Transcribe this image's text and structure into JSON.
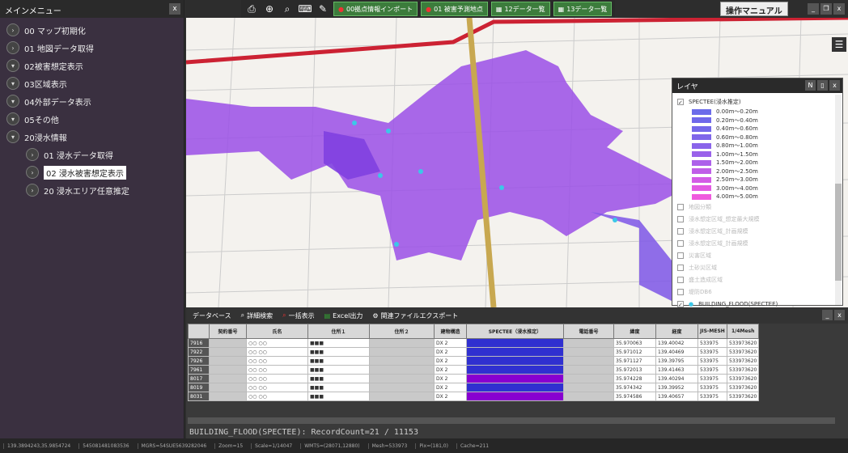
{
  "sidebar": {
    "title": "メインメニュー",
    "close": "x",
    "items": [
      {
        "label": "00 マップ初期化",
        "icon": "›"
      },
      {
        "label": "01 地図データ取得",
        "icon": "›"
      },
      {
        "label": "02被害想定表示",
        "icon": "▾"
      },
      {
        "label": "03区域表示",
        "icon": "▾"
      },
      {
        "label": "04外部データ表示",
        "icon": "▾"
      },
      {
        "label": "05その他",
        "icon": "▾"
      },
      {
        "label": "20浸水情報",
        "icon": "▾"
      }
    ],
    "subitems": [
      {
        "label": "01 浸水データ取得"
      },
      {
        "label": "02 浸水被害想定表示"
      },
      {
        "label": "20 浸水エリア任意推定"
      }
    ]
  },
  "toolbar": {
    "btn1": "00拠点情報インポート",
    "btn2": "01 被害予測地点",
    "btn3": "12データ一覧",
    "btn4": "13データ一覧",
    "manual": "操作マニュアル"
  },
  "layer": {
    "title": "レイヤ",
    "group": "SPECTEE(浸水推定)",
    "legend": [
      {
        "label": "0.00m〜0.20m",
        "color": "#6b6bea"
      },
      {
        "label": "0.20m〜0.40m",
        "color": "#6f68ea"
      },
      {
        "label": "0.40m〜0.60m",
        "color": "#7468ea"
      },
      {
        "label": "0.60m〜0.80m",
        "color": "#7f66ea"
      },
      {
        "label": "0.80m〜1.00m",
        "color": "#8a64ea"
      },
      {
        "label": "1.00m〜1.50m",
        "color": "#9a62ea"
      },
      {
        "label": "1.50m〜2.00m",
        "color": "#ad60ea"
      },
      {
        "label": "2.00m〜2.50m",
        "color": "#c05ee8"
      },
      {
        "label": "2.50m〜3.00m",
        "color": "#d35ce6"
      },
      {
        "label": "3.00m〜4.00m",
        "color": "#e35ae3"
      },
      {
        "label": "4.00m〜5.00m",
        "color": "#ef5ade"
      }
    ],
    "layers": [
      "地図分類",
      "浸水想定区域_想定最大規模",
      "浸水想定区域_計画規模",
      "浸水想定区域_計画規模",
      "災害区域",
      "土砂災区域",
      "盛土造成区域",
      "堤防DB6"
    ],
    "building": "BUILDING_FLOOD(SPECTEE)"
  },
  "bottom": {
    "tools": [
      "データベース",
      "詳細検索",
      "一括表示",
      "Excel出力",
      "関連ファイルエクスポート"
    ],
    "columns": [
      "",
      "契約番号",
      "氏名",
      "住所１",
      "住所２",
      "建物構造",
      "SPECTEE（浸水推定）",
      "電話番号",
      "緯度",
      "経度",
      "JIS-MESH",
      "1/4Mesh"
    ],
    "rows": [
      {
        "id": "7916",
        "name": "○○ ○○",
        "addr": "■■■",
        "s1": "DX",
        "s2": "2",
        "lat": "35.970063",
        "lon": "139.40042",
        "mesh": "533975",
        "q": "533973620",
        "color": "#3030d0"
      },
      {
        "id": "7922",
        "name": "○○ ○○",
        "addr": "■■■",
        "s1": "DX",
        "s2": "2",
        "lat": "35.971012",
        "lon": "139.40469",
        "mesh": "533975",
        "q": "533973620",
        "color": "#3030d0"
      },
      {
        "id": "7926",
        "name": "○○ ○○",
        "addr": "■■■",
        "s1": "DX",
        "s2": "2",
        "lat": "35.971127",
        "lon": "139.39795",
        "mesh": "533975",
        "q": "533973620",
        "color": "#3030d0"
      },
      {
        "id": "7961",
        "name": "○○ ○○",
        "addr": "■■■",
        "s1": "DX",
        "s2": "2",
        "lat": "35.972013",
        "lon": "139.41463",
        "mesh": "533975",
        "q": "533973620",
        "color": "#3030d0"
      },
      {
        "id": "8017",
        "name": "○○ ○○",
        "addr": "■■■",
        "s1": "DX",
        "s2": "2",
        "lat": "35.974228",
        "lon": "139.40294",
        "mesh": "533975",
        "q": "533973620",
        "color": "#8800d0"
      },
      {
        "id": "8019",
        "name": "○○ ○○",
        "addr": "■■■",
        "s1": "DX",
        "s2": "2",
        "lat": "35.974342",
        "lon": "139.39952",
        "mesh": "533975",
        "q": "533973620",
        "color": "#3030d0"
      },
      {
        "id": "8031",
        "name": "○○ ○○",
        "addr": "■■■",
        "s1": "DX",
        "s2": "2",
        "lat": "35.974586",
        "lon": "139.40657",
        "mesh": "533975",
        "q": "533973620",
        "color": "#8800d0"
      }
    ],
    "record": "BUILDING_FLOOD(SPECTEE): RecordCount=21 / 11153"
  },
  "status": [
    "139.3894243,35.9854724",
    "545081481083536",
    "MGRS=54SUE5639282046",
    "Zoom=15",
    "Scale=1/14047",
    "WMTS=(28071,12880)",
    "Mesh=533973",
    "Pix=(181,0)",
    "Cache=211"
  ]
}
